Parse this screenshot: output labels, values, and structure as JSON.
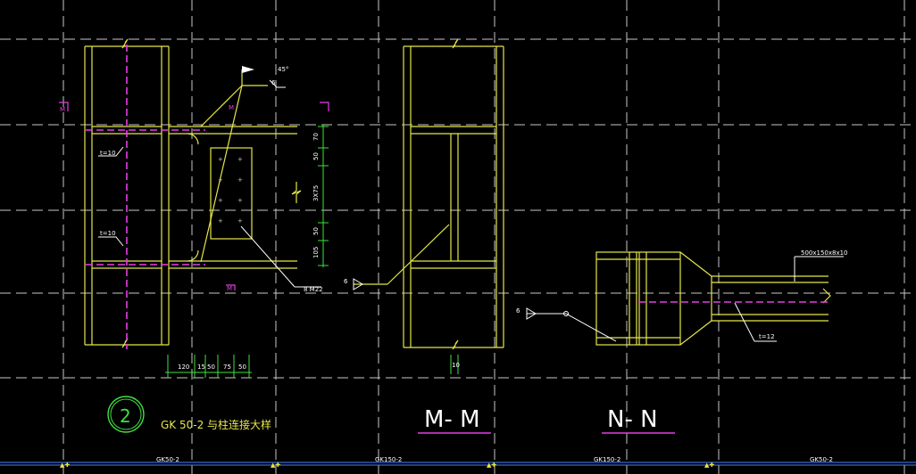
{
  "colors": {
    "background": "#000000",
    "steel": "#e6e64a",
    "dashed_centerline": "#e43fe4",
    "grid": "#c8c8c8",
    "annotation": "#ffffff",
    "detail_circle": "#40e040",
    "bottom_axis": "#4a7fff"
  },
  "detail_left": {
    "section_marks": [
      "M",
      "M",
      "M"
    ],
    "plate_labels": [
      "t=10",
      "t=10"
    ],
    "weld_leg": "6",
    "weld_angle": "45°",
    "bolt_label": "8 M22",
    "vertical_dims": [
      "70",
      "50",
      "3X75",
      "50",
      "105"
    ],
    "bottom_dims": [
      "120",
      "15",
      "50",
      "75",
      "50"
    ]
  },
  "detail_number": "2",
  "detail_title": "GK 50-2 与柱连接大样",
  "section_mm": {
    "title": "M- M",
    "weld_leg": "6",
    "bottom_mark": "10"
  },
  "section_nn": {
    "title": "N- N",
    "weld_leg": "6",
    "beam_size": "500x150x8x10",
    "plate_label": "t=12"
  },
  "bottom_axis_labels": [
    "GK50-2",
    "GK150-2",
    "GK150-2",
    "GK50-2"
  ]
}
